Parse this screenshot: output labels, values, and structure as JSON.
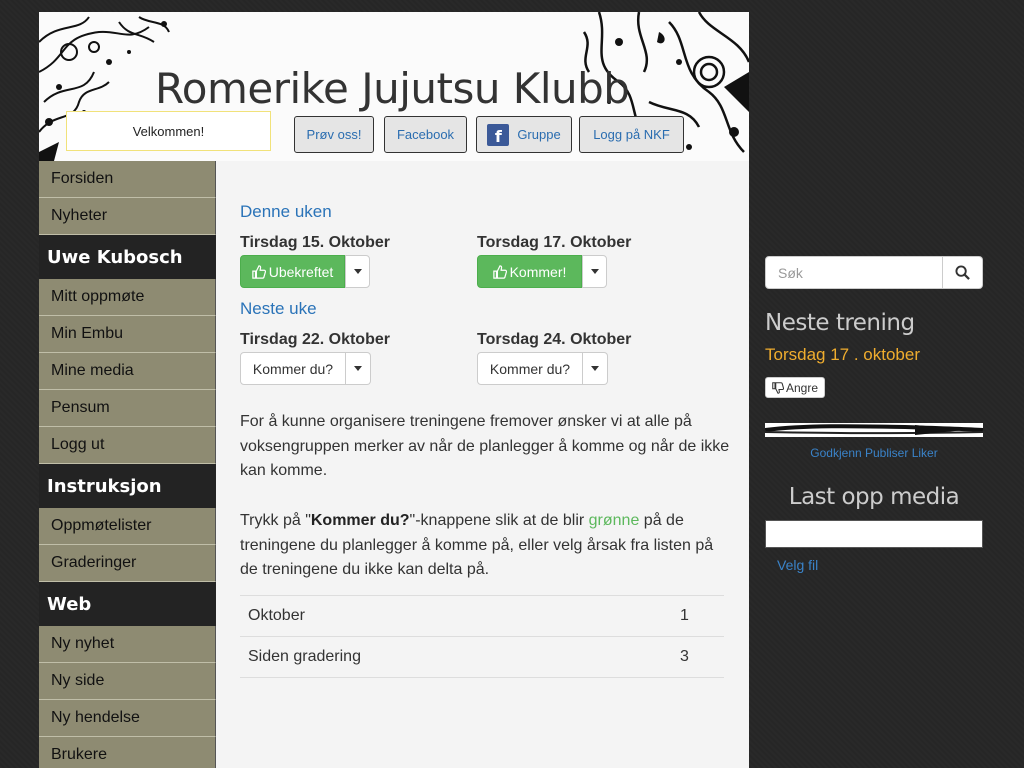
{
  "header": {
    "site_title": "Romerike Jujutsu Klubb",
    "welcome": "Velkommen!",
    "buttons": [
      {
        "label": "Prøv oss!"
      },
      {
        "label": "Facebook"
      },
      {
        "label": "Gruppe",
        "icon": "facebook-icon"
      },
      {
        "label": "Logg på NKF"
      }
    ]
  },
  "sidebar": {
    "items_top": [
      "Forsiden",
      "Nyheter"
    ],
    "user_heading": "Uwe Kubosch",
    "user_items": [
      "Mitt oppmøte",
      "Min Embu",
      "Mine media",
      "Pensum",
      "Logg ut"
    ],
    "instr_heading": "Instruksjon",
    "instr_items": [
      "Oppmøtelister",
      "Graderinger"
    ],
    "web_heading": "Web",
    "web_items": [
      "Ny nyhet",
      "Ny side",
      "Ny hendelse",
      "Brukere"
    ]
  },
  "main": {
    "this_week_title": "Denne uken",
    "next_week_title": "Neste uke",
    "sessions": [
      {
        "day": "Tirsdag 15. Oktober",
        "button": "Ubekreftet",
        "state": "green",
        "icon": "thumbs-up-icon"
      },
      {
        "day": "Torsdag 17. Oktober",
        "button": "Kommer!",
        "state": "green",
        "icon": "thumbs-up-icon"
      },
      {
        "day": "Tirsdag 22. Oktober",
        "button": "Kommer du?",
        "state": "default"
      },
      {
        "day": "Torsdag 24. Oktober",
        "button": "Kommer du?",
        "state": "default"
      }
    ],
    "para1": "For å kunne organisere treningene fremover ønsker vi at alle på voksengruppen merker av når de planlegger å komme og når de ikke kan komme.",
    "para2": {
      "pre": "Trykk på \"",
      "bold": "Kommer du?",
      "mid": "\"-knappene slik at de blir ",
      "green": "grønne",
      "post": " på de treningene du planlegger å komme på, eller velg årsak fra listen på de treningene du ikke kan delta på."
    },
    "stats": [
      {
        "label": "Oktober",
        "value": "1"
      },
      {
        "label": "Siden gradering",
        "value": "3"
      }
    ]
  },
  "right": {
    "search_placeholder": "Søk",
    "next_training_title": "Neste trening",
    "next_training_date": "Torsdag 17 . oktober",
    "angre_label": "Angre",
    "media_actions": "Godkjenn Publiser Liker",
    "upload_title": "Last opp media",
    "choose_file": "Velg fil"
  },
  "colors": {
    "accent_blue": "#2a73b8",
    "success_green": "#5cb85c",
    "sidebar_olive": "#8e8b72",
    "orange_date": "#f0ad2e"
  }
}
